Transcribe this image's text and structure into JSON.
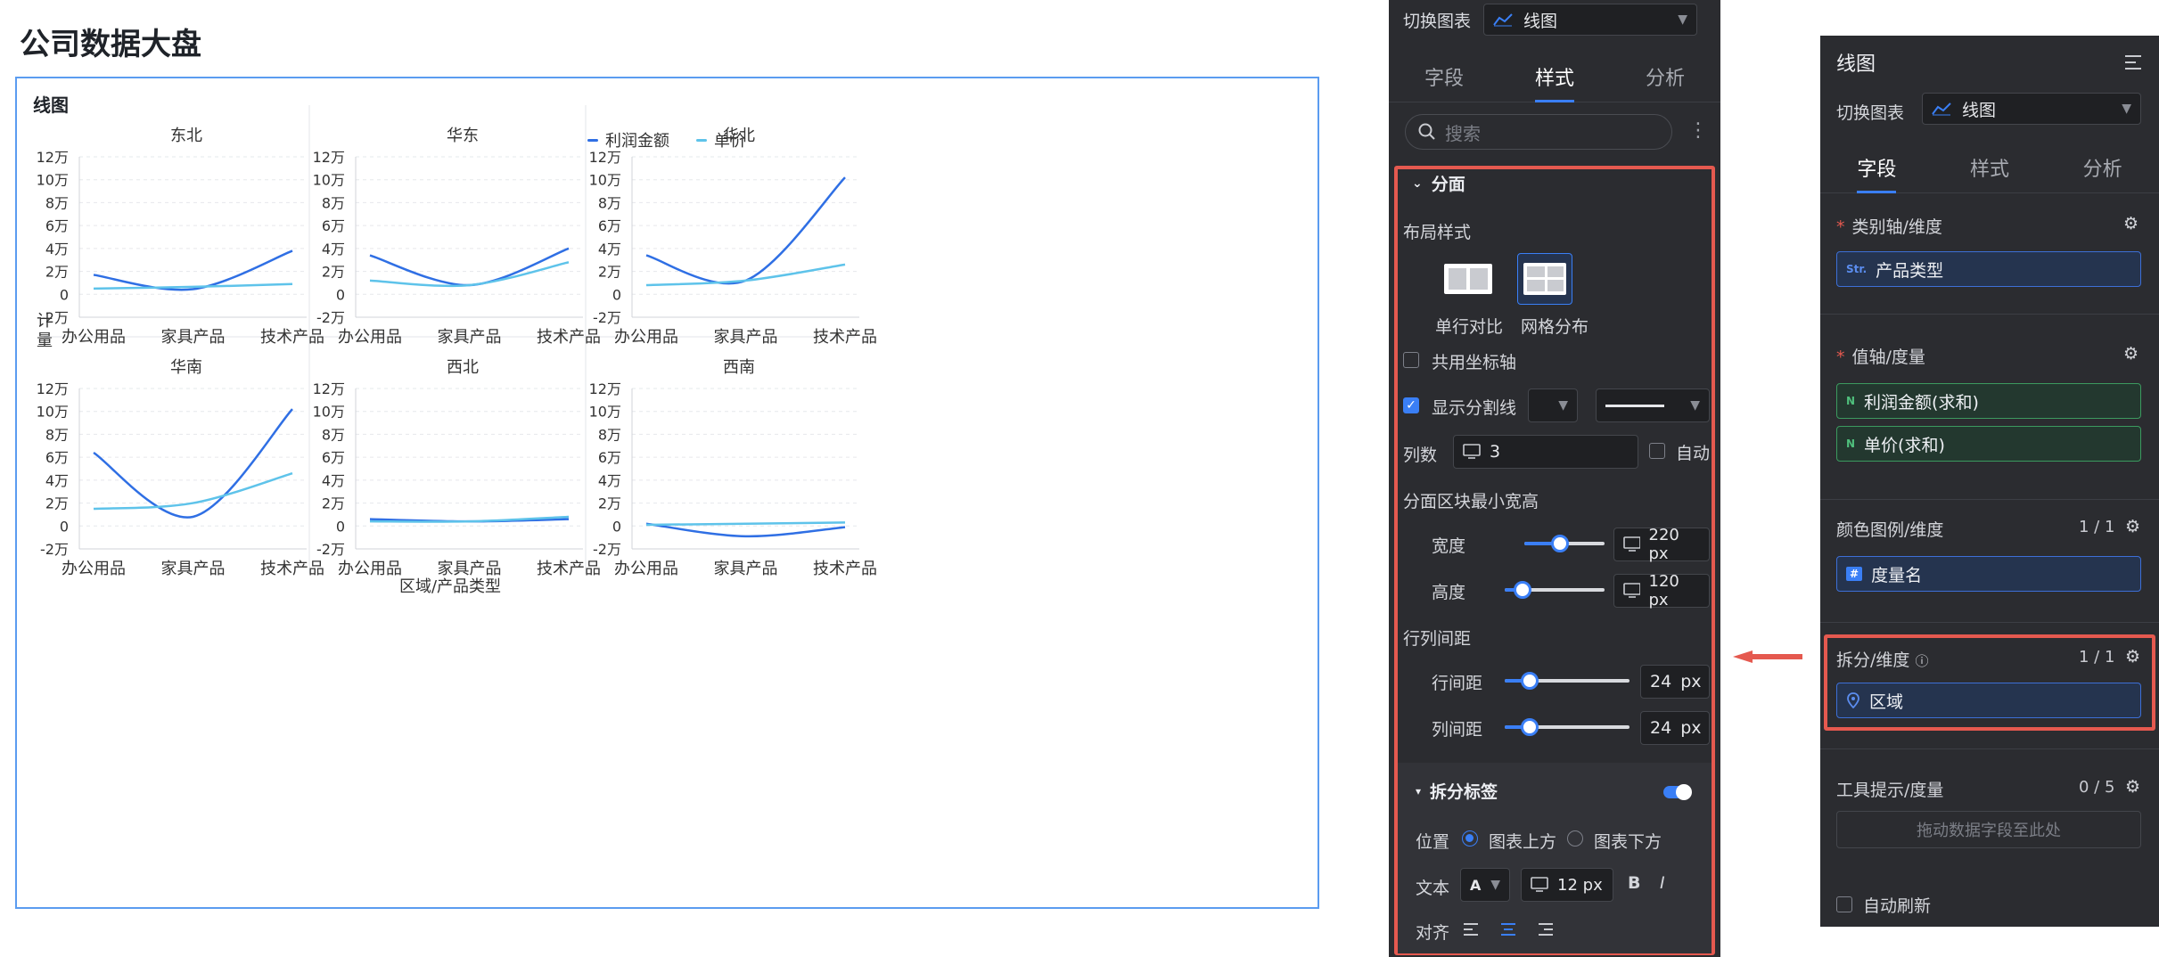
{
  "page_title": "公司数据大盘",
  "card": {
    "title": "线图",
    "legend": [
      {
        "label": "利润金额",
        "color": "#2f6fe4"
      },
      {
        "label": "单价",
        "color": "#5ec3ea"
      }
    ],
    "y_axis_label": "计量",
    "x_axis_label": "区域/产品类型"
  },
  "chart_data": {
    "type": "line",
    "categories": [
      "办公用品",
      "家具产品",
      "技术产品"
    ],
    "y_ticks": [
      "12万",
      "10万",
      "8万",
      "6万",
      "4万",
      "2万",
      "0",
      "-2万"
    ],
    "ylim": [
      -20000,
      120000
    ],
    "grid": true,
    "legend_position": "top-center",
    "panels": [
      {
        "title": "东北",
        "series": [
          {
            "name": "利润金额",
            "values": [
              17000,
              4500,
              38000
            ]
          },
          {
            "name": "单价",
            "values": [
              5000,
              6500,
              9000
            ]
          }
        ]
      },
      {
        "title": "华东",
        "series": [
          {
            "name": "利润金额",
            "values": [
              34000,
              8000,
              40000
            ]
          },
          {
            "name": "单价",
            "values": [
              12000,
              8000,
              28000
            ]
          }
        ]
      },
      {
        "title": "华北",
        "series": [
          {
            "name": "利润金额",
            "values": [
              34000,
              12000,
              102000
            ]
          },
          {
            "name": "单价",
            "values": [
              8000,
              12000,
              26000
            ]
          }
        ]
      },
      {
        "title": "华南",
        "series": [
          {
            "name": "利润金额",
            "values": [
              64000,
              8000,
              102000
            ]
          },
          {
            "name": "单价",
            "values": [
              15000,
              20000,
              46000
            ]
          }
        ]
      },
      {
        "title": "西北",
        "series": [
          {
            "name": "利润金额",
            "values": [
              6000,
              4000,
              6000
            ]
          },
          {
            "name": "单价",
            "values": [
              4000,
              4000,
              8000
            ]
          }
        ]
      },
      {
        "title": "西南",
        "series": [
          {
            "name": "利润金额",
            "values": [
              2000,
              -9000,
              -1000
            ]
          },
          {
            "name": "单价",
            "values": [
              1000,
              2000,
              3000
            ]
          }
        ]
      }
    ]
  },
  "style_panel": {
    "switch_label": "切换图表",
    "chart_type": "线图",
    "tabs": [
      "字段",
      "样式",
      "分析"
    ],
    "active_tab": "样式",
    "search_placeholder": "搜索",
    "section_facet": "分面",
    "layout_style": "布局样式",
    "layout_options": [
      "单行对比",
      "网格分布"
    ],
    "share_axis": "共用坐标轴",
    "show_divider": "显示分割线",
    "columns_label": "列数",
    "columns_value": "3",
    "auto_label": "自动",
    "min_size_label": "分面区块最小宽高",
    "width_label": "宽度",
    "width_value": "220",
    "height_label": "高度",
    "height_value": "120",
    "gap_label": "行列间距",
    "row_gap_label": "行间距",
    "row_gap_value": "24",
    "col_gap_label": "列间距",
    "col_gap_value": "24",
    "px": "px",
    "split_label_section": "拆分标签",
    "position_label": "位置",
    "pos_above": "图表上方",
    "pos_below": "图表下方",
    "text_label": "文本",
    "font_glyph": "A",
    "font_size": "12",
    "bold": "B",
    "italic": "I",
    "align_label": "对齐"
  },
  "field_panel": {
    "title": "线图",
    "switch_label": "切换图表",
    "chart_type": "线图",
    "tabs": [
      "字段",
      "样式",
      "分析"
    ],
    "active_tab": "字段",
    "category_axis": "类别轴/维度",
    "category_field": "产品类型",
    "category_tag": "Str.",
    "value_axis": "值轴/度量",
    "value_fields": [
      "利润金额(求和)",
      "单价(求和)"
    ],
    "value_tag": "N",
    "color_legend": "颜色图例/维度",
    "color_count": "1 / 1",
    "color_field": "度量名",
    "split_dim": "拆分/维度",
    "split_count": "1 / 1",
    "split_field": "区域",
    "tooltip": "工具提示/度量",
    "tooltip_count": "0 / 5",
    "tooltip_placeholder": "拖动数据字段至此处",
    "auto_refresh": "自动刷新"
  }
}
